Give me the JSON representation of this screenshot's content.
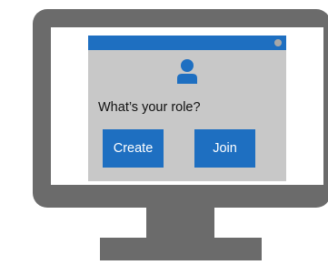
{
  "dialog": {
    "prompt": "What’s your role?",
    "create_label": "Create",
    "join_label": "Join"
  },
  "icons": {
    "user": "user-icon",
    "window_control": "window-dot-icon"
  },
  "colors": {
    "monitor": "#6b6b6b",
    "accent": "#1e6fc1",
    "window_background": "#c8c8c8",
    "screen": "#ffffff"
  }
}
